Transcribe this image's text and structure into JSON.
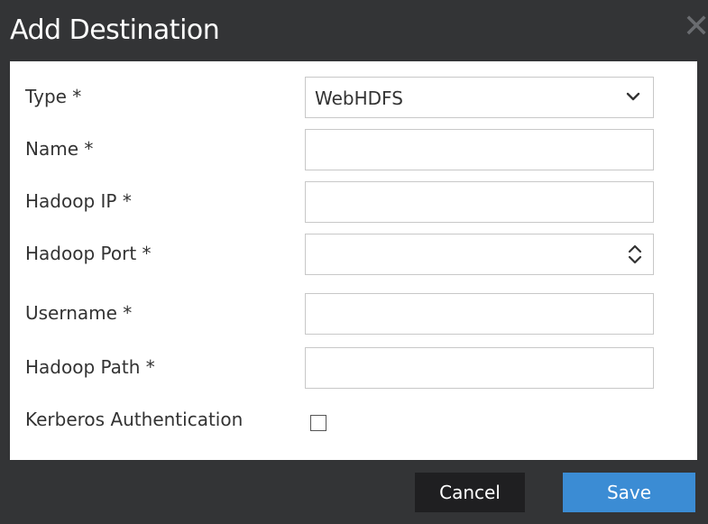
{
  "dialog": {
    "title": "Add Destination",
    "close_icon": "close-icon"
  },
  "form": {
    "type": {
      "label": "Type *",
      "selected": "WebHDFS"
    },
    "name": {
      "label": "Name *",
      "value": ""
    },
    "hadoop_ip": {
      "label": "Hadoop IP *",
      "value": ""
    },
    "hadoop_port": {
      "label": "Hadoop Port *",
      "value": ""
    },
    "username": {
      "label": "Username *",
      "value": ""
    },
    "hadoop_path": {
      "label": "Hadoop Path *",
      "value": ""
    },
    "kerberos": {
      "label": "Kerberos Authentication",
      "checked": false
    }
  },
  "footer": {
    "cancel_label": "Cancel",
    "save_label": "Save"
  },
  "colors": {
    "frame": "#333436",
    "save_button": "#3b8cd4",
    "cancel_button": "#1f1f21"
  }
}
